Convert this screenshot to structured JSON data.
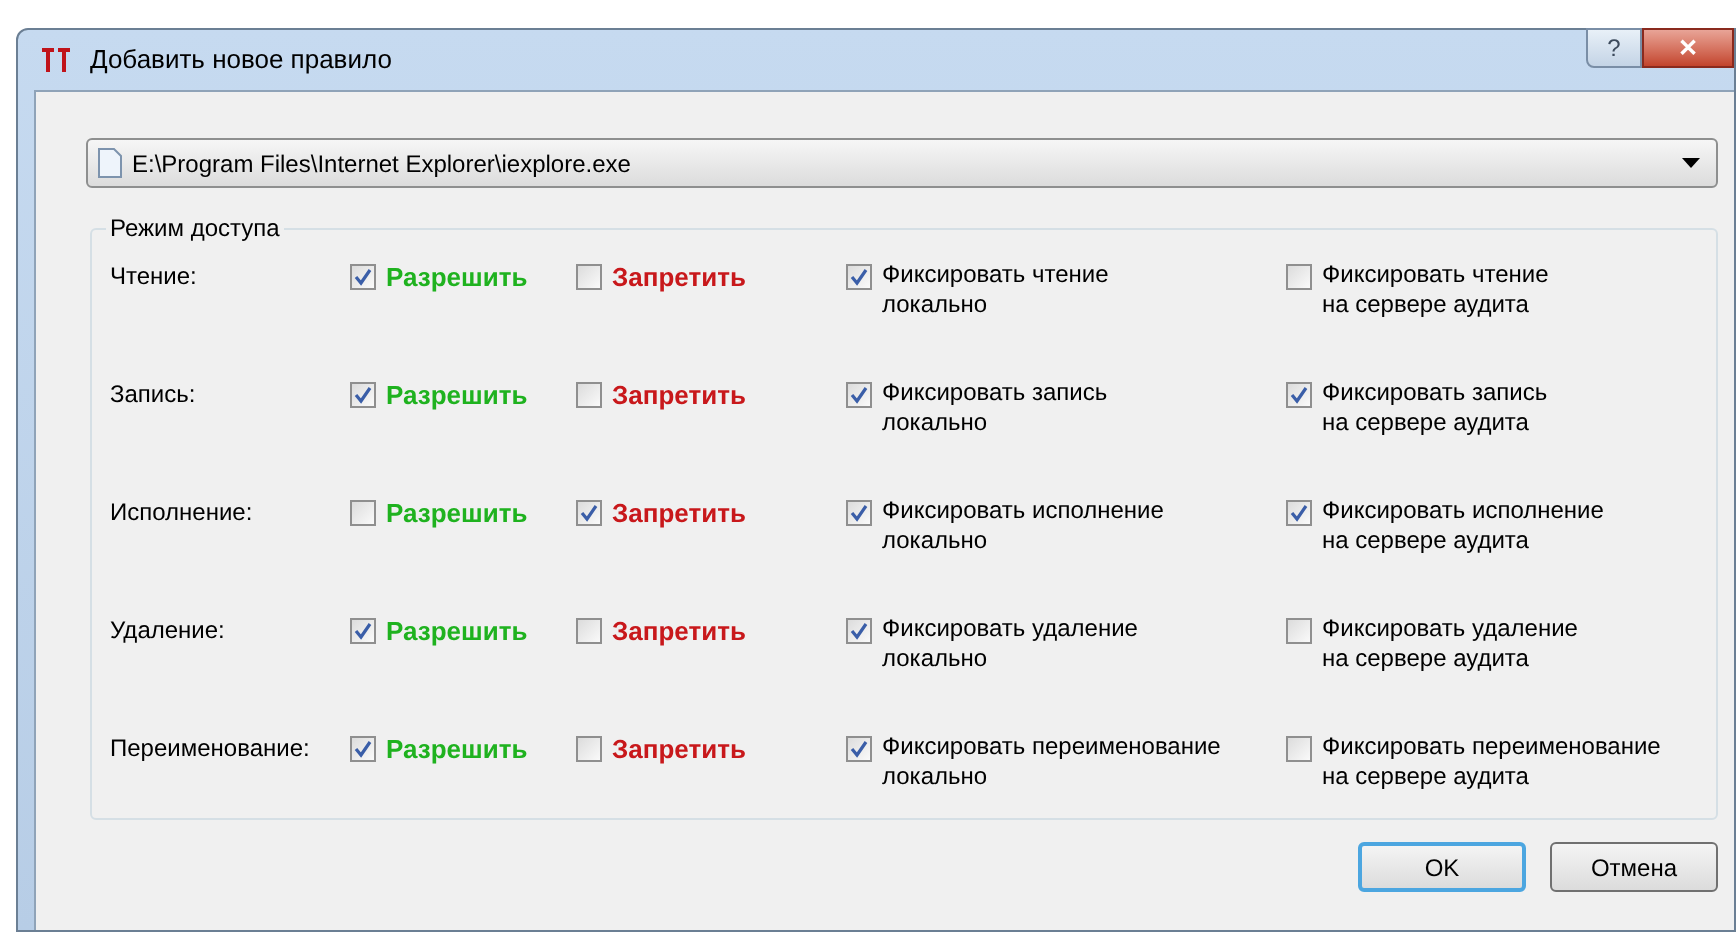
{
  "window": {
    "title": "Добавить новое правило",
    "help": "?",
    "close": "✕"
  },
  "path_select": {
    "value": "E:\\Program Files\\Internet Explorer\\iexplore.exe"
  },
  "group": {
    "title": "Режим доступа"
  },
  "rows": [
    {
      "label": "Чтение:",
      "allow": {
        "label": "Разрешить",
        "checked": true
      },
      "deny": {
        "label": "Запретить",
        "checked": false
      },
      "log_local": {
        "label": "Фиксировать чтение\nлокально",
        "checked": true
      },
      "log_server": {
        "label": "Фиксировать чтение\nна сервере аудита",
        "checked": false
      }
    },
    {
      "label": "Запись:",
      "allow": {
        "label": "Разрешить",
        "checked": true
      },
      "deny": {
        "label": "Запретить",
        "checked": false
      },
      "log_local": {
        "label": "Фиксировать запись\nлокально",
        "checked": true
      },
      "log_server": {
        "label": "Фиксировать запись\nна сервере аудита",
        "checked": true
      }
    },
    {
      "label": "Исполнение:",
      "allow": {
        "label": "Разрешить",
        "checked": false
      },
      "deny": {
        "label": "Запретить",
        "checked": true
      },
      "log_local": {
        "label": "Фиксировать исполнение\nлокально",
        "checked": true
      },
      "log_server": {
        "label": "Фиксировать исполнение\nна сервере аудита",
        "checked": true
      }
    },
    {
      "label": "Удаление:",
      "allow": {
        "label": "Разрешить",
        "checked": true
      },
      "deny": {
        "label": "Запретить",
        "checked": false
      },
      "log_local": {
        "label": "Фиксировать удаление\nлокально",
        "checked": true
      },
      "log_server": {
        "label": "Фиксировать удаление\nна сервере аудита",
        "checked": false
      }
    },
    {
      "label": "Переименование:",
      "allow": {
        "label": "Разрешить",
        "checked": true
      },
      "deny": {
        "label": "Запретить",
        "checked": false
      },
      "log_local": {
        "label": "Фиксировать переименование\nлокально",
        "checked": true
      },
      "log_server": {
        "label": "Фиксировать переименование\nна сервере аудита",
        "checked": false
      }
    }
  ],
  "buttons": [
    {
      "label": "OK",
      "default": true
    },
    {
      "label": "Отмена",
      "default": false
    }
  ]
}
